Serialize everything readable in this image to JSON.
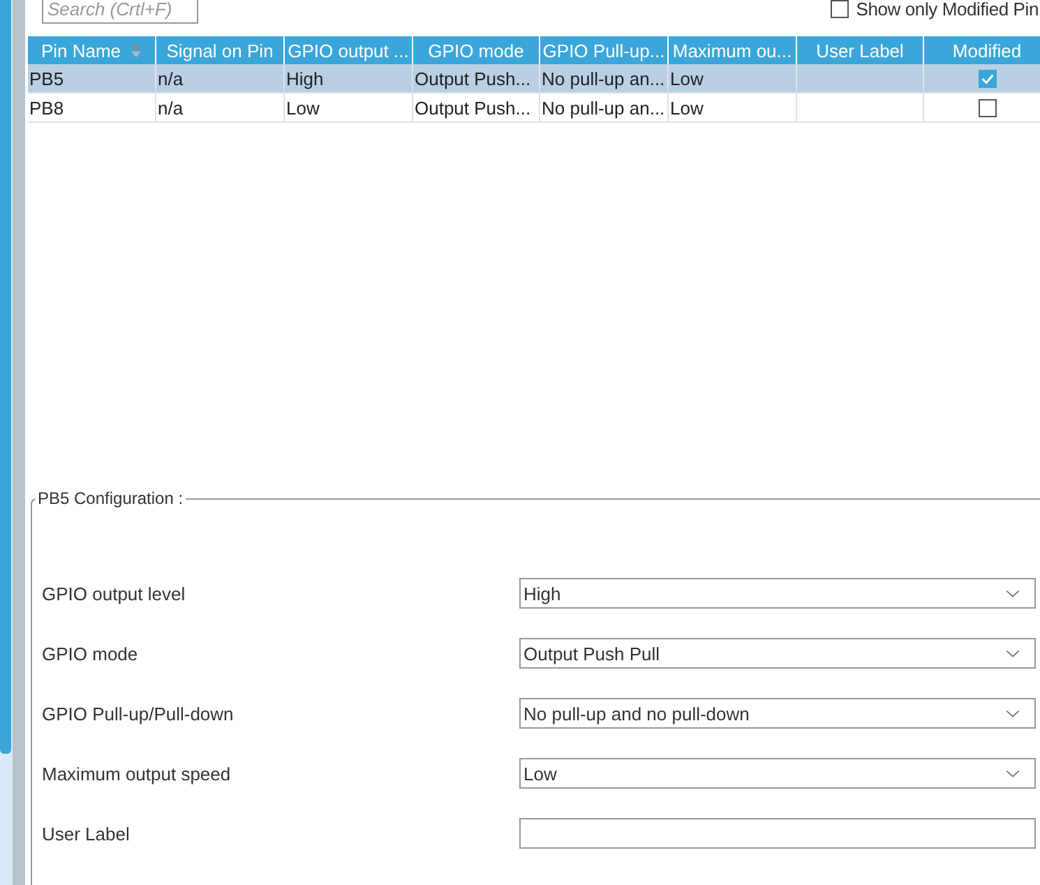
{
  "search": {
    "placeholder": "Search (Crtl+F)"
  },
  "filter": {
    "label": "Show only Modified Pin",
    "checked": false
  },
  "table": {
    "columns": [
      {
        "label": "Pin Name",
        "sorted": true
      },
      {
        "label": "Signal on Pin",
        "sorted": false
      },
      {
        "label": "GPIO output ...",
        "sorted": false
      },
      {
        "label": "GPIO mode",
        "sorted": false
      },
      {
        "label": "GPIO Pull-up...",
        "sorted": false
      },
      {
        "label": "Maximum ou...",
        "sorted": false
      },
      {
        "label": "User Label",
        "sorted": false
      },
      {
        "label": "Modified",
        "sorted": false
      }
    ],
    "rows": [
      {
        "selected": true,
        "cells": [
          "PB5",
          "n/a",
          "High",
          "Output Push...",
          "No pull-up an...",
          "Low",
          ""
        ],
        "modified": true
      },
      {
        "selected": false,
        "cells": [
          "PB8",
          "n/a",
          "Low",
          "Output Push...",
          "No pull-up an...",
          "Low",
          ""
        ],
        "modified": false
      }
    ]
  },
  "config": {
    "title": "PB5 Configuration :",
    "fields": [
      {
        "label": "GPIO output level",
        "kind": "dropdown",
        "value": "High"
      },
      {
        "label": "GPIO mode",
        "kind": "dropdown",
        "value": "Output Push Pull"
      },
      {
        "label": "GPIO Pull-up/Pull-down",
        "kind": "dropdown",
        "value": "No pull-up and no pull-down"
      },
      {
        "label": "Maximum output speed",
        "kind": "dropdown",
        "value": "Low"
      },
      {
        "label": "User Label",
        "kind": "text"
      }
    ]
  }
}
